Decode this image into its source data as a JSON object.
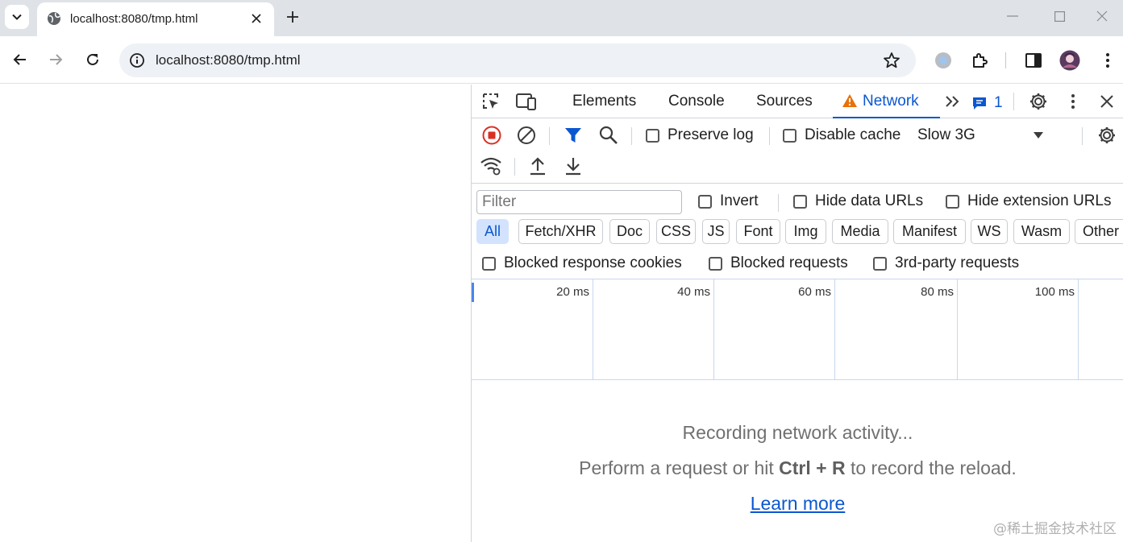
{
  "browser": {
    "tab": {
      "title": "localhost:8080/tmp.html"
    },
    "omnibox": {
      "url": "localhost:8080/tmp.html"
    }
  },
  "devtools": {
    "tabs": [
      {
        "label": "Elements"
      },
      {
        "label": "Console"
      },
      {
        "label": "Sources"
      },
      {
        "label": "Network",
        "active": true
      }
    ],
    "issues_count": "1",
    "toolbar": {
      "preserve_log": "Preserve log",
      "disable_cache": "Disable cache",
      "throttling": "Slow 3G"
    },
    "filter": {
      "placeholder": "Filter",
      "invert": "Invert",
      "hide_data_urls": "Hide data URLs",
      "hide_extension_urls": "Hide extension URLs"
    },
    "type_filters": [
      "All",
      "Fetch/XHR",
      "Doc",
      "CSS",
      "JS",
      "Font",
      "Img",
      "Media",
      "Manifest",
      "WS",
      "Wasm",
      "Other"
    ],
    "more_filters": {
      "blocked_response_cookies": "Blocked response cookies",
      "blocked_requests": "Blocked requests",
      "third_party_requests": "3rd-party requests"
    },
    "timeline_ticks": [
      "20 ms",
      "40 ms",
      "60 ms",
      "80 ms",
      "100 ms"
    ],
    "empty_state": {
      "recording": "Recording network activity...",
      "perform_prefix": "Perform a request or hit ",
      "shortcut": "Ctrl + R",
      "perform_suffix": " to record the reload.",
      "learn_more": "Learn more"
    }
  },
  "watermark": "@稀土掘金技术社区",
  "colors": {
    "accent": "#0b57d0",
    "record_red": "#d93025",
    "warning_orange": "#e8710a",
    "chip_active_bg": "#d3e3fd"
  }
}
